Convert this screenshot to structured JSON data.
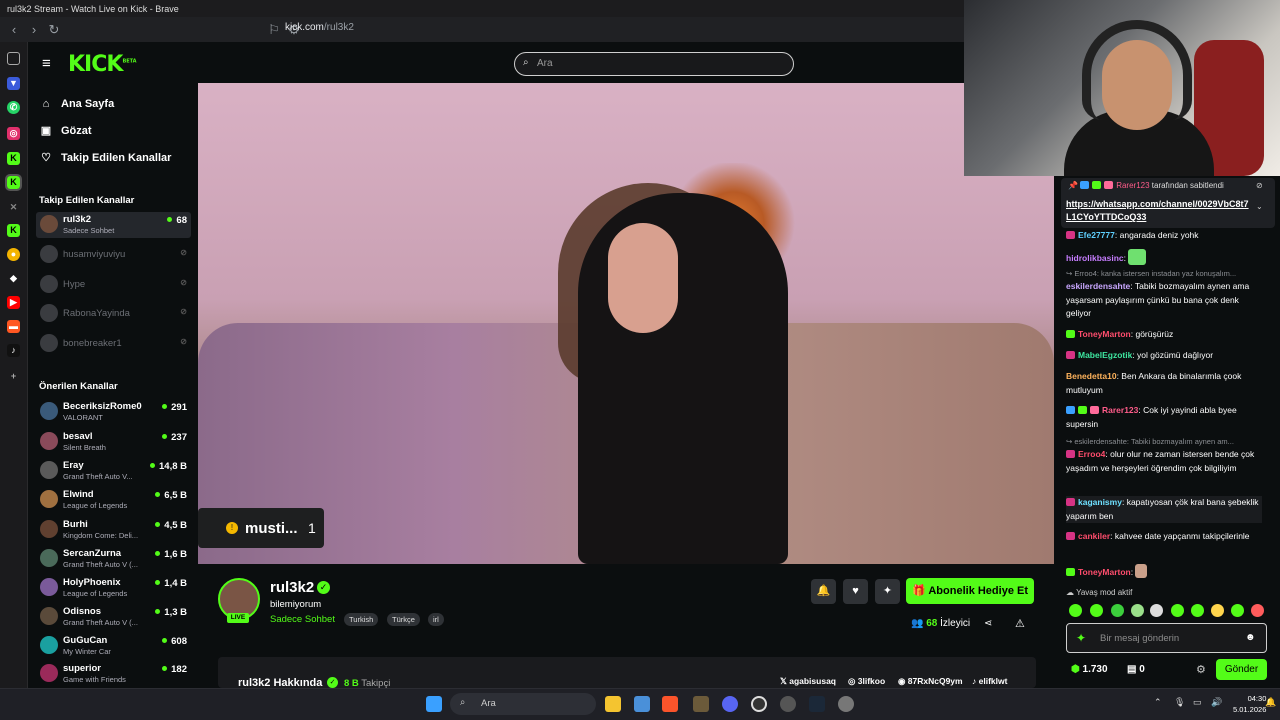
{
  "window": {
    "title": "rul3k2 Stream - Watch Live on Kick - Brave"
  },
  "browser": {
    "url_domain": "kick.com",
    "url_path": "/rul3k2"
  },
  "header": {
    "logo": "KICK",
    "logo_sup": "BETA",
    "search_placeholder": "Ara"
  },
  "nav": [
    {
      "label": "Ana Sayfa",
      "icon": "home-icon"
    },
    {
      "label": "Gözat",
      "icon": "browse-icon"
    },
    {
      "label": "Takip Edilen Kanallar",
      "icon": "heart-icon"
    }
  ],
  "followed": {
    "title": "Takip Edilen Kanallar",
    "items": [
      {
        "name": "rul3k2",
        "sub": "Sadece Sohbet",
        "viewers": "68"
      },
      {
        "name": "husamviyuviyu"
      },
      {
        "name": "Hype"
      },
      {
        "name": "RabonaYayinda"
      },
      {
        "name": "bonebreaker1"
      }
    ]
  },
  "recommended": {
    "title": "Önerilen Kanallar",
    "items": [
      {
        "name": "BeceriksizRome0",
        "sub": "VALORANT",
        "viewers": "291"
      },
      {
        "name": "besavl",
        "sub": "Silent Breath",
        "viewers": "237"
      },
      {
        "name": "Eray",
        "sub": "Grand Theft Auto V...",
        "viewers": "14,8 B"
      },
      {
        "name": "Elwind",
        "sub": "League of Legends",
        "viewers": "6,5 B"
      },
      {
        "name": "Burhi",
        "sub": "Kingdom Come: Deli...",
        "viewers": "4,5 B"
      },
      {
        "name": "SercanZurna",
        "sub": "Grand Theft Auto V (...",
        "viewers": "1,6 B"
      },
      {
        "name": "HolyPhoenix",
        "sub": "League of Legends",
        "viewers": "1,4 B"
      },
      {
        "name": "Odisnos",
        "sub": "Grand Theft Auto V (...",
        "viewers": "1,3 B"
      },
      {
        "name": "GuGuCan",
        "sub": "My Winter Car",
        "viewers": "608"
      },
      {
        "name": "superior",
        "sub": "Game with Friends",
        "viewers": "182"
      }
    ]
  },
  "prediction": {
    "text": "musti...",
    "count": "1"
  },
  "channel": {
    "name": "rul3k2",
    "live": "LIVE",
    "title": "bilemiyorum",
    "category": "Sadece Sohbet",
    "tags": [
      "Turkish",
      "Türkçe",
      "irl"
    ],
    "gift_label": "Abonelik Hediye Et",
    "viewers": "68",
    "viewers_label": "İzleyici",
    "about_title": "rul3k2 Hakkında",
    "followers": "8 B",
    "followers_label": "Takipçi",
    "socials": [
      "agabisusaq",
      "3lifkoo",
      "87RxNcQ9ym",
      "elifklwt"
    ]
  },
  "chat": {
    "pinned_by": "Rarer123",
    "pinned_suffix": "tarafından sabitlendi",
    "pinned_link": "https://whatsapp.com/channel/0029VbC8t7L1CYoYTTDCoQ33",
    "messages": [
      {
        "user": "Efe27777",
        "color": "#5fd0ff",
        "text": "angarada deniz yohk"
      },
      {
        "user": "hidrolikbasinc",
        "color": "#c77dff",
        "text": ""
      },
      {
        "reply": "Erroo4: kanka istersen instadan yaz konuşalım..."
      },
      {
        "user": "eskilerdensahte",
        "color": "#c9a7ff",
        "text": "Tabiki bozmayalım aynen ama yaşarsam paylaşırım çünkü bu bana çok denk geliyor"
      },
      {
        "user": "ToneyMarton",
        "color": "#ff4d6d",
        "text": "görüşürüz"
      },
      {
        "user": "MabelEgzotik",
        "color": "#3ee6a0",
        "text": "yol gözümü dağlıyor"
      },
      {
        "user": "Benedetta10",
        "color": "#ffb35c",
        "text": "Ben Ankara da binalarımla çook mutluyum"
      },
      {
        "user": "Rarer123",
        "color": "#ff5c8a",
        "text": "Cok iyi yayindi abla byee supersin"
      },
      {
        "reply": "eskilerdensahte: Tabiki bozmayalım aynen am..."
      },
      {
        "user": "Erroo4",
        "color": "#ff4d6d",
        "text": "olur olur ne zaman istersen bende çok yaşadım ve herşeyleri öğrendim çok bilgiliyim"
      },
      {
        "user": "kaganismy",
        "color": "#6fe0ff",
        "text": "kapatıyosan çök kral bana şebeklik yaparım ben"
      },
      {
        "user": "cankiler",
        "color": "#ff4d6d",
        "text": "kahvee date yapçanmı takipçilerinle"
      },
      {
        "user": "ToneyMarton",
        "color": "#ff4d6d",
        "text": ""
      }
    ],
    "slow_mode": "Yavaş mod aktif",
    "input_placeholder": "Bir mesaj gönderin",
    "points": "1.730",
    "points2": "0",
    "send_label": "Gönder"
  },
  "taskbar": {
    "search": "Ara",
    "time": "04:30",
    "date": "5.01.2026"
  },
  "colors": {
    "accent": "#53fc18",
    "background": "#0b0e0f"
  }
}
